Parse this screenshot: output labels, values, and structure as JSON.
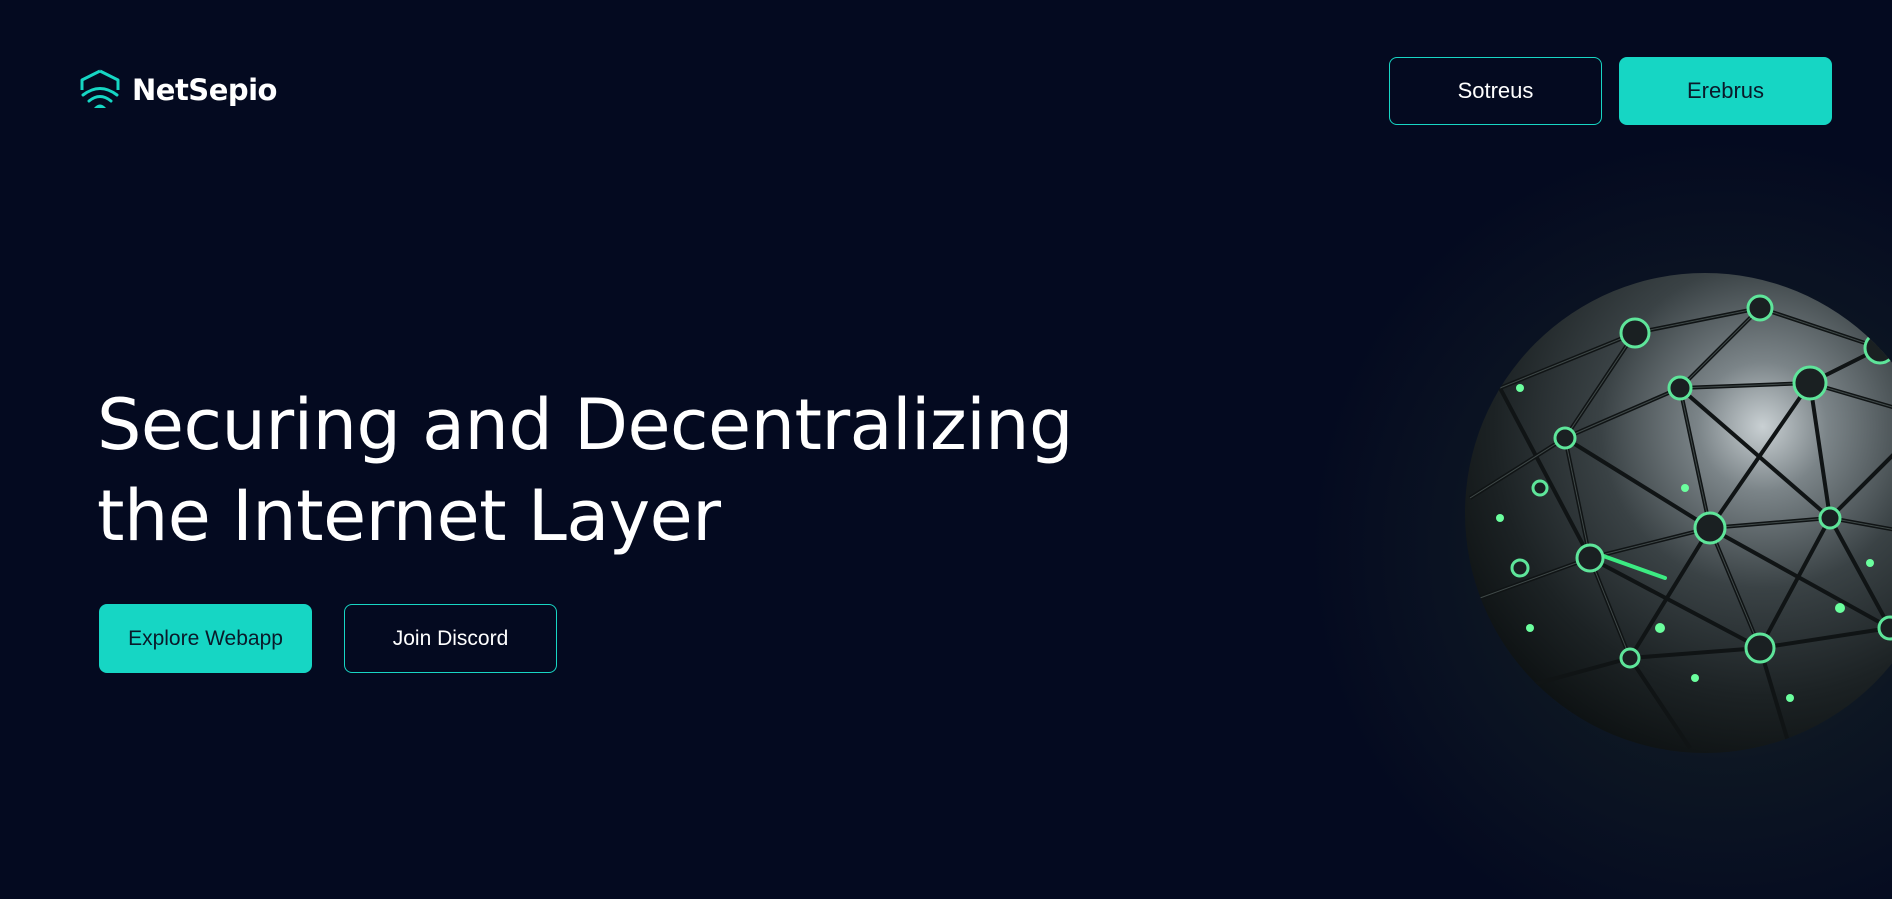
{
  "brand": {
    "name": "NetSepio",
    "logo_icon": "shield-wifi-icon",
    "accent_color": "#16d6c4",
    "background_color": "#040a20"
  },
  "header": {
    "buttons": [
      {
        "label": "Sotreus",
        "style": "outline"
      },
      {
        "label": "Erebrus",
        "style": "filled"
      }
    ]
  },
  "hero": {
    "title_line1": "Securing and Decentralizing",
    "title_line2": "the Internet Layer",
    "primary_button": "Explore Webapp",
    "secondary_button": "Join Discord"
  },
  "visual": {
    "globe_icon": "network-globe-icon"
  }
}
